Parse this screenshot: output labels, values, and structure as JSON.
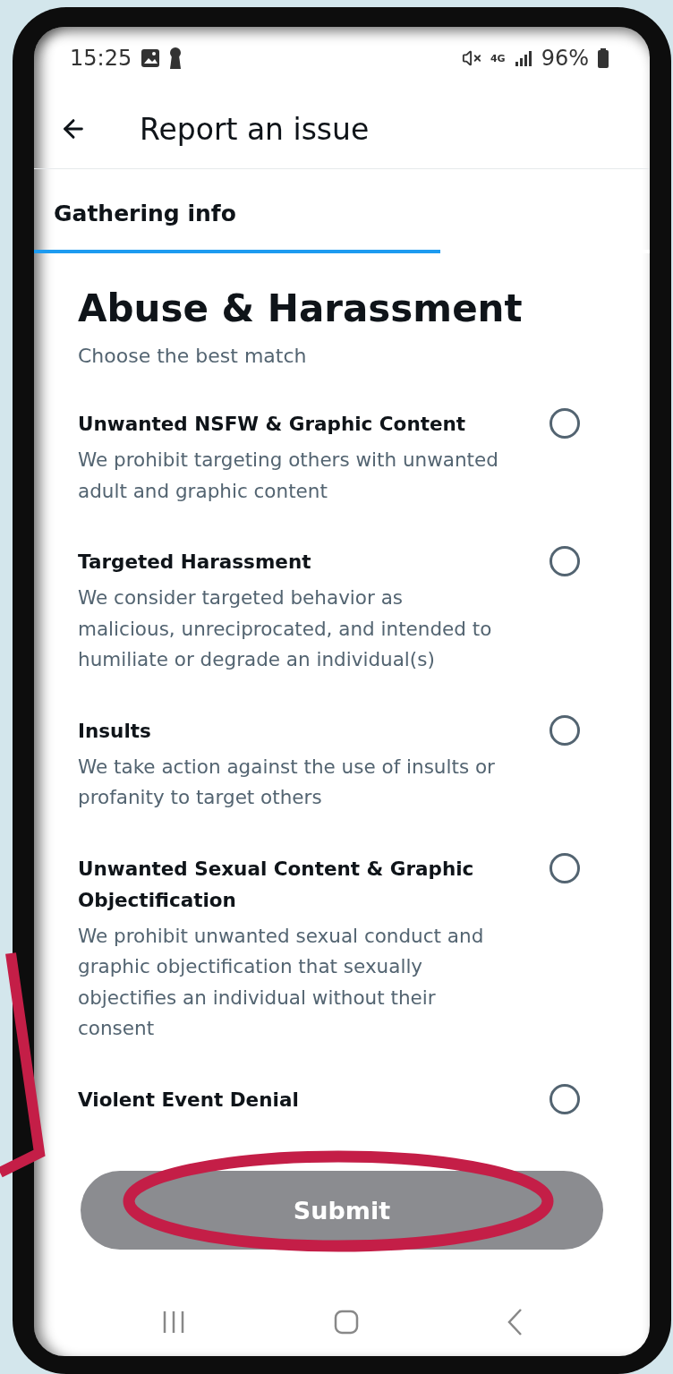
{
  "status_bar": {
    "time": "15:25",
    "network": "4G",
    "battery": "96%"
  },
  "header": {
    "title": "Report an issue"
  },
  "progress": {
    "label": "Gathering info",
    "level": 0.66
  },
  "section": {
    "title": "Abuse & Harassment",
    "subtitle": "Choose the best match"
  },
  "options": [
    {
      "title": "Unwanted NSFW & Graphic Content",
      "description": "We prohibit targeting others with unwanted adult and graphic content",
      "selected": false
    },
    {
      "title": "Targeted Harassment",
      "description": "We consider targeted behavior as malicious, unreciprocated, and intended to humiliate or degrade an individual(s)",
      "selected": false
    },
    {
      "title": "Insults",
      "description": "We take action against the use of insults or profanity to target others",
      "selected": false
    },
    {
      "title": "Unwanted Sexual Content & Graphic Objectification",
      "description": "We prohibit unwanted sexual conduct and graphic objectification that sexually objectifies an individual without their consent",
      "selected": false
    },
    {
      "title": "Violent Event Denial",
      "selected": false
    }
  ],
  "submit": {
    "label": "Submit",
    "disabled": true
  }
}
